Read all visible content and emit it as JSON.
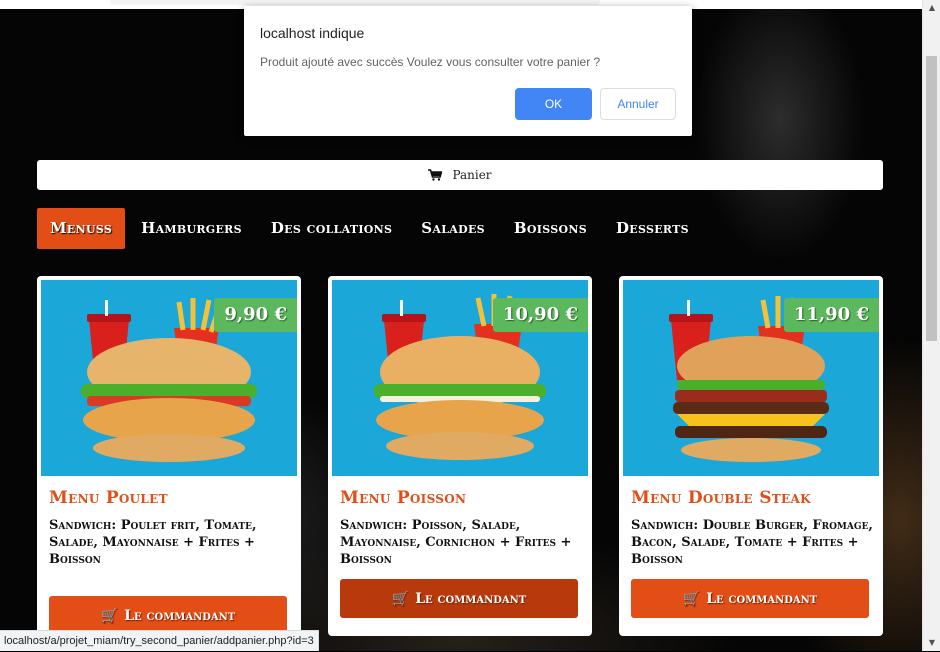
{
  "dialog": {
    "title": "localhost indique",
    "message": "Produit ajouté avec succès Voulez vous consulter votre panier ?",
    "ok_label": "OK",
    "cancel_label": "Annuler"
  },
  "cart": {
    "label": "Panier",
    "icon": "cart-icon"
  },
  "tabs": [
    {
      "label": "Menuss",
      "active": true
    },
    {
      "label": "Hamburgers",
      "active": false
    },
    {
      "label": "Des collations",
      "active": false
    },
    {
      "label": "Salades",
      "active": false
    },
    {
      "label": "Boissons",
      "active": false
    },
    {
      "label": "Desserts",
      "active": false
    }
  ],
  "cards": [
    {
      "title": "Menu Poulet",
      "description": "Sandwich: Poulet frit, Tomate, Salade, Mayonnaise + Frites + Boisson",
      "price": "9,90 €",
      "button": "Le commandant"
    },
    {
      "title": "Menu Poisson",
      "description": "Sandwich: Poisson, Salade, Mayonnaise, Cornichon + Frites + Boisson",
      "price": "10,90 €",
      "button": "Le commandant"
    },
    {
      "title": "Menu Double Steak",
      "description": "Sandwich: Double Burger, Fromage, Bacon, Salade, Tomate + Frites + Boisson",
      "price": "11,90 €",
      "button": "Le commandant"
    }
  ],
  "status_url": "localhost/a/projet_miam/try_second_panier/addpanier.php?id=3",
  "colors": {
    "accent": "#e34d16",
    "price_badge": "#5cb85c",
    "image_bg": "#1ba7d8",
    "dialog_button": "#4285f4"
  }
}
